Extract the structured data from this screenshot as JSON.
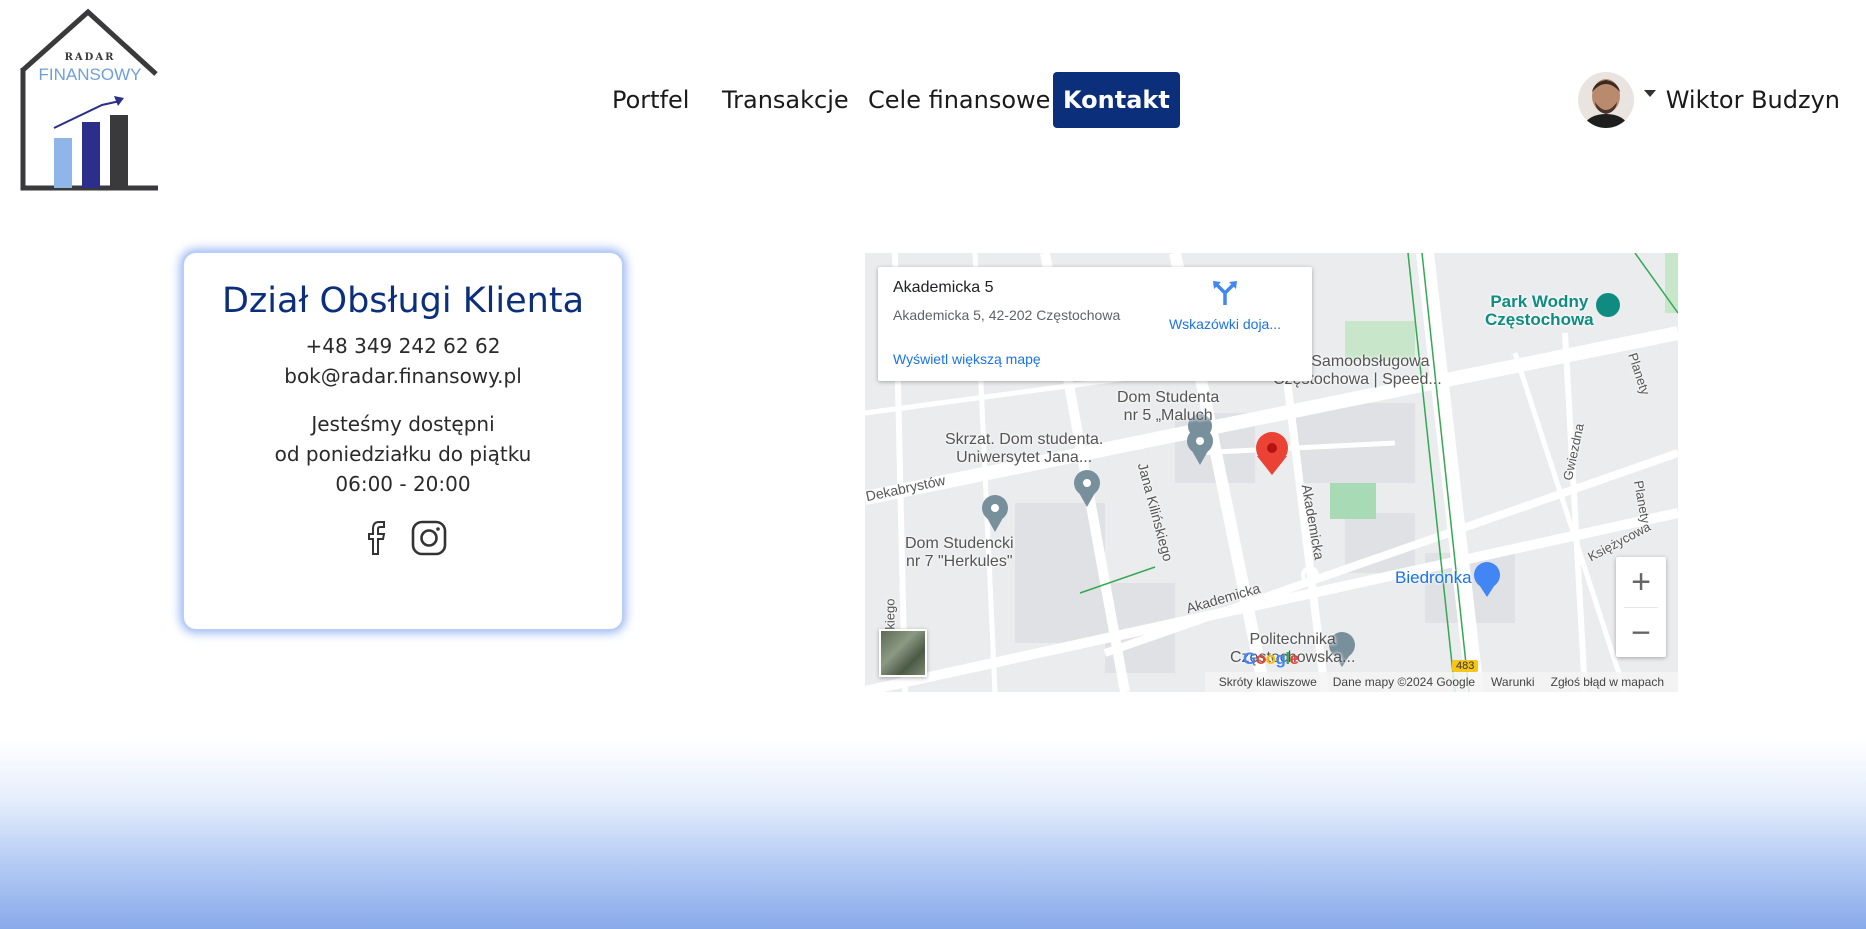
{
  "brand": {
    "logo_line1": "RADAR",
    "logo_line2": "FINANSOWY"
  },
  "nav": {
    "items": [
      {
        "label": "Portfel"
      },
      {
        "label": "Transakcje"
      },
      {
        "label": "Cele finansowe"
      },
      {
        "label": "Kontakt",
        "active": true
      }
    ]
  },
  "user": {
    "name": "Wiktor Budzyn"
  },
  "contact": {
    "title": "Dział Obsługi Klienta",
    "phone": "+48 349 242 62 62",
    "email": "bok@radar.finansowy.pl",
    "availability_line1": "Jesteśmy dostępni",
    "availability_line2": "od poniedziałku do piątku",
    "hours": "06:00 - 20:00",
    "social_icons": [
      "facebook-icon",
      "instagram-icon"
    ]
  },
  "map": {
    "place_title": "Akademicka 5",
    "place_address": "Akademicka 5, 42-202 Częstochowa",
    "directions_label": "Wskazówki doja...",
    "larger_map_link": "Wyświetl większą mapę",
    "zoom_in": "+",
    "zoom_out": "−",
    "labels": {
      "park": "Park Wodny\nCzęstochowa",
      "carwash": "alnia Samoobsługowa\nCzęstochowa | Speed...",
      "dom5": "Dom Studenta\nnr 5 „Maluch",
      "skrzat": "Skrzat. Dom studenta.\nUniwersytet Jana...",
      "dekabrystow": "Dekabrystów",
      "kilinskiego": "Jana Kilińskiego",
      "akademicka_v": "Akademicka",
      "akademicka_h": "Akademicka",
      "dom7": "Dom Studencki\nnr 7 \"Herkules\"",
      "gwiezdna": "Gwiezdna",
      "planety1": "Planety",
      "planety2": "Planety",
      "ksiezycowa": "Księżycowa",
      "biedronka": "Biedronka",
      "politechnika": "Politechnika\nCzęstochowska...",
      "zickiego": "zickiego",
      "road_number": "483"
    },
    "footer": {
      "shortcuts": "Skróty klawiszowe",
      "data": "Dane mapy ©2024 Google",
      "terms": "Warunki",
      "report": "Zgłoś błąd w mapach"
    },
    "google_mark": "Google"
  },
  "colors": {
    "brand_navy": "#0b2f7a",
    "map_link": "#1a73e8",
    "marker_red": "#ea4335"
  }
}
